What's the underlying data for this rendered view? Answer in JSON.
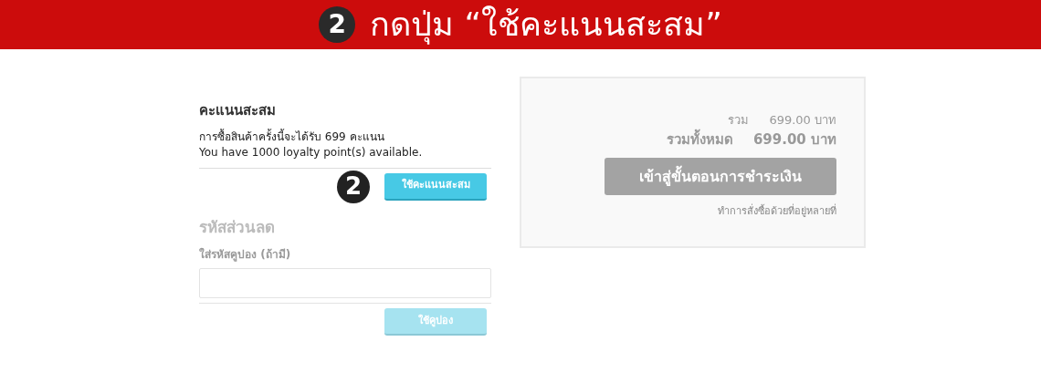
{
  "banner": {
    "step": "2",
    "text": "กดปุ่ม “ใช้คะแนนสะสม”"
  },
  "loyalty": {
    "title": "คะแนนสะสม",
    "earn_text": "การซื้อสินค้าครั้งนี้จะได้รับ 699 คะแนน",
    "available_text": "You have 1000 loyalty point(s) available.",
    "step": "2",
    "button": {
      "label": "ใช้คะแนนสะสม",
      "disabled": false
    }
  },
  "coupon": {
    "title": "รหัสส่วนลด",
    "field_label": "ใส่รหัสคูปอง (ถ้ามี)",
    "button": {
      "label": "ใช้คูปอง",
      "disabled": true
    }
  },
  "summary": {
    "subtotal_label": "รวม",
    "subtotal_value": "699.00 บาท",
    "total_label": "รวมทั้งหมด",
    "total_value": "699.00 บาท",
    "checkout_button": "เข้าสู่ขั้นตอนการชำระเงิน",
    "multi_address_link": "ทำการสั่งซื้อด้วยที่อยู่หลายที่"
  }
}
